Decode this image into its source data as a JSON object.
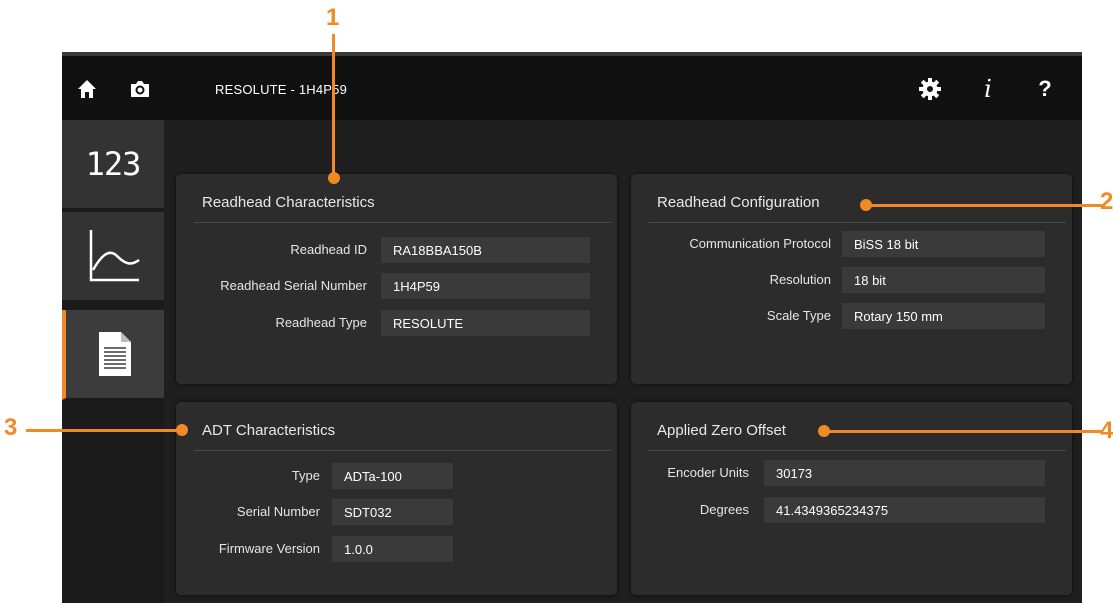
{
  "header": {
    "title": "RESOLUTE - 1H4P59",
    "home_icon": "home-icon",
    "camera_icon": "camera-icon",
    "settings_icon": "gear-icon",
    "info_label": "i",
    "help_label": "?"
  },
  "sidebar": {
    "items": [
      {
        "name": "numeric-readout",
        "label": "123",
        "active": false
      },
      {
        "name": "graph",
        "icon": "graph-icon",
        "active": false
      },
      {
        "name": "document",
        "icon": "document-icon",
        "active": true
      }
    ]
  },
  "panels": {
    "readhead_characteristics": {
      "title": "Readhead Characteristics",
      "rows": [
        {
          "label": "Readhead ID",
          "value": "RA18BBA150B"
        },
        {
          "label": "Readhead Serial Number",
          "value": "1H4P59"
        },
        {
          "label": "Readhead Type",
          "value": "RESOLUTE"
        }
      ]
    },
    "readhead_configuration": {
      "title": "Readhead Configuration",
      "rows": [
        {
          "label": "Communication Protocol",
          "value": "BiSS 18 bit"
        },
        {
          "label": "Resolution",
          "value": "18 bit"
        },
        {
          "label": "Scale Type",
          "value": "Rotary 150 mm"
        }
      ]
    },
    "adt_characteristics": {
      "title": "ADT Characteristics",
      "rows": [
        {
          "label": "Type",
          "value": "ADTa-100"
        },
        {
          "label": "Serial Number",
          "value": "SDT032"
        },
        {
          "label": "Firmware Version",
          "value": "1.0.0"
        }
      ]
    },
    "applied_zero_offset": {
      "title": "Applied Zero Offset",
      "rows": [
        {
          "label": "Encoder Units",
          "value": "30173"
        },
        {
          "label": "Degrees",
          "value": "41.4349365234375"
        }
      ]
    }
  },
  "callouts": [
    "1",
    "2",
    "3",
    "4"
  ],
  "colors": {
    "accent": "#f08a24",
    "topbar": "#111111",
    "background": "#1f1f1f",
    "panel": "#2c2c2c",
    "field": "#3a3a3a"
  }
}
